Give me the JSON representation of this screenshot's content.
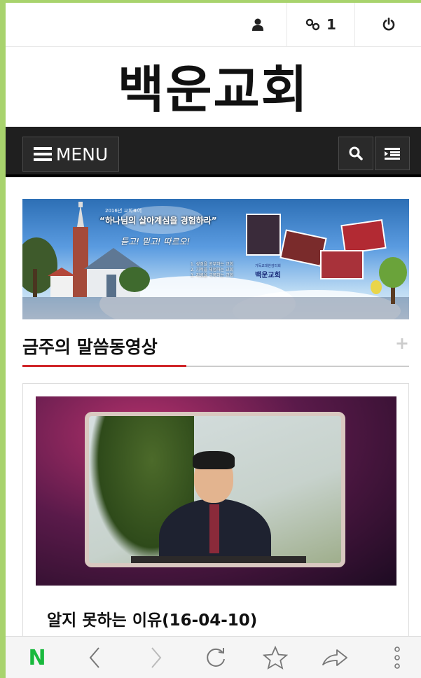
{
  "topbar": {
    "user_icon": "user-icon",
    "link_icon": "link-icon",
    "link_count": "1",
    "power_icon": "power-icon"
  },
  "site": {
    "title": "백운교회"
  },
  "nav": {
    "menu_label": "MENU",
    "search_icon": "search-icon",
    "list_icon": "list-indent-icon"
  },
  "banner": {
    "subtitle": "2016년 교회표어",
    "title": "“하나님의 살아계심을 경험하라”",
    "handwriting": "듣고! 믿고! 따르오!",
    "points": [
      "1. 성경을 공부하는 교회",
      "2. 기적을 체험하는 교회",
      "3. 지병을 극복하는 교회"
    ],
    "church_sub": "기독교대한감리회",
    "church_name": "백운교회"
  },
  "section": {
    "title": "금주의 말씀동영상",
    "more": "+"
  },
  "video": {
    "title": "알지 못하는 이유(16-04-10)"
  },
  "browser": {
    "logo": "N",
    "icons": [
      "back-icon",
      "forward-icon",
      "reload-icon",
      "star-icon",
      "share-icon",
      "more-icon"
    ]
  },
  "colors": {
    "frame": "#a8d36d",
    "nav_bg": "#1f1f1f",
    "accent": "#d0262a",
    "naver_green": "#19b93d"
  }
}
